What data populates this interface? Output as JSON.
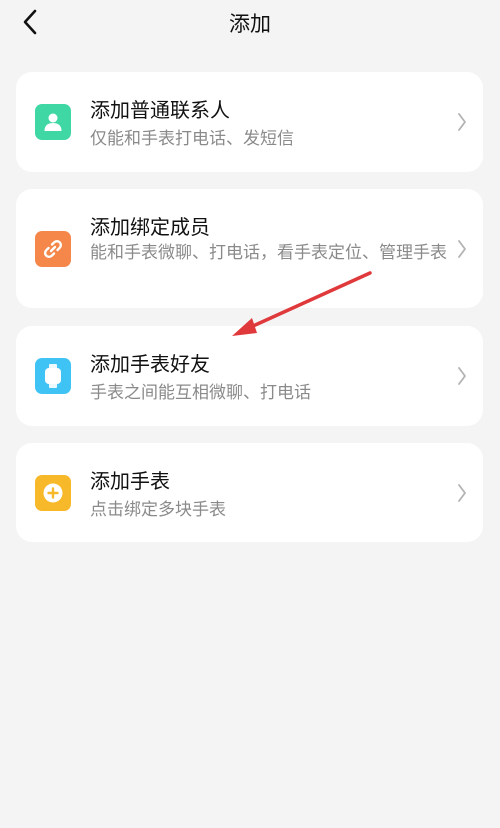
{
  "header": {
    "title": "添加",
    "back_icon": "chevron-left-icon"
  },
  "colors": {
    "background": "#f4f4f4",
    "card": "#ffffff",
    "contact_icon": "#3fd8a4",
    "member_icon": "#f5874a",
    "friend_icon": "#3fc3f4",
    "watch_icon": "#f7b82a",
    "annotation_arrow": "#e0393b"
  },
  "items": [
    {
      "title": "添加普通联系人",
      "desc": "仅能和手表打电话、发短信",
      "icon": "person-icon"
    },
    {
      "title": "添加绑定成员",
      "desc": "能和手表微聊、打电话，看手表定位、管理手表",
      "icon": "link-icon"
    },
    {
      "title": "添加手表好友",
      "desc": "手表之间能互相微聊、打电话",
      "icon": "watch-icon"
    },
    {
      "title": "添加手表",
      "desc": "点击绑定多块手表",
      "icon": "plus-icon"
    }
  ]
}
